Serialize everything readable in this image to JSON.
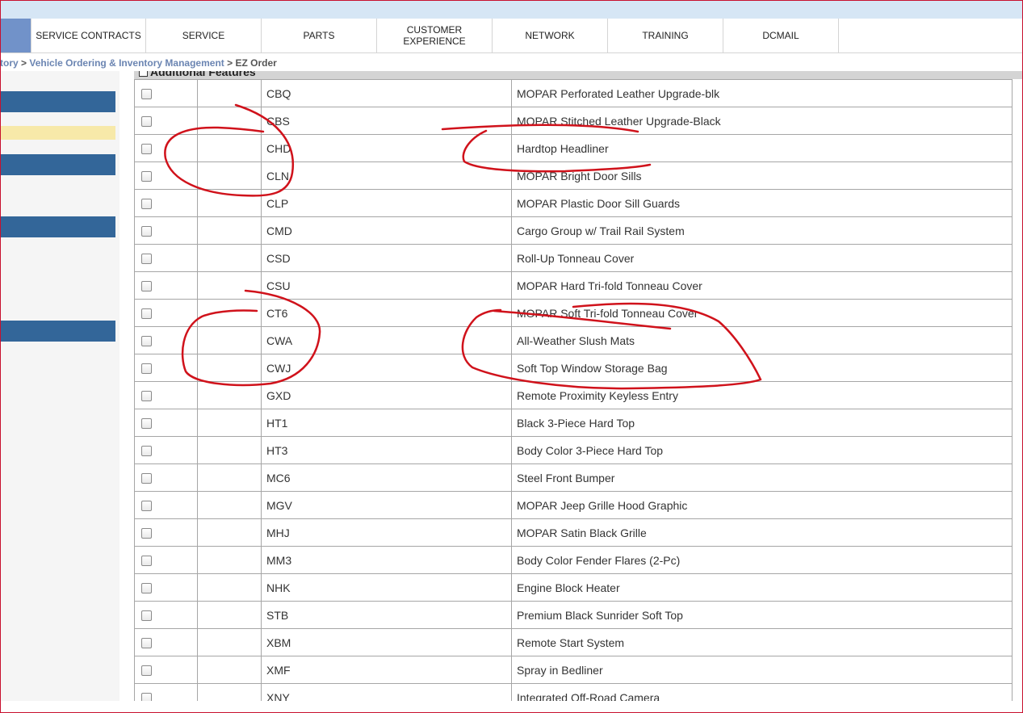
{
  "nav": {
    "tabs": [
      {
        "label": "SERVICE CONTRACTS"
      },
      {
        "label": "SERVICE"
      },
      {
        "label": "PARTS"
      },
      {
        "label": "CUSTOMER EXPERIENCE"
      },
      {
        "label": "NETWORK"
      },
      {
        "label": "TRAINING"
      },
      {
        "label": "DCMAIL"
      }
    ]
  },
  "breadcrumb": {
    "item1": "tory",
    "sep1": ">",
    "item2": "Vehicle Ordering & Inventory Management",
    "sep2": ">",
    "current": "EZ Order"
  },
  "section": {
    "title": "Additional Features"
  },
  "options": [
    {
      "code": "CBQ",
      "description": "MOPAR Perforated Leather Upgrade-blk"
    },
    {
      "code": "CBS",
      "description": "MOPAR Stitched Leather Upgrade-Black"
    },
    {
      "code": "CHD",
      "description": "Hardtop Headliner"
    },
    {
      "code": "CLN",
      "description": "MOPAR Bright Door Sills"
    },
    {
      "code": "CLP",
      "description": "MOPAR Plastic Door Sill Guards"
    },
    {
      "code": "CMD",
      "description": "Cargo Group w/ Trail Rail System"
    },
    {
      "code": "CSD",
      "description": "Roll-Up Tonneau Cover"
    },
    {
      "code": "CSU",
      "description": "MOPAR Hard Tri-fold Tonneau Cover"
    },
    {
      "code": "CT6",
      "description": "MOPAR Soft Tri-fold Tonneau Cover"
    },
    {
      "code": "CWA",
      "description": "All-Weather Slush Mats"
    },
    {
      "code": "CWJ",
      "description": "Soft Top Window Storage Bag"
    },
    {
      "code": "GXD",
      "description": "Remote Proximity Keyless Entry"
    },
    {
      "code": "HT1",
      "description": "Black 3-Piece Hard Top"
    },
    {
      "code": "HT3",
      "description": "Body Color 3-Piece Hard Top"
    },
    {
      "code": "MC6",
      "description": "Steel Front Bumper"
    },
    {
      "code": "MGV",
      "description": "MOPAR Jeep Grille Hood Graphic"
    },
    {
      "code": "MHJ",
      "description": "MOPAR Satin Black Grille"
    },
    {
      "code": "MM3",
      "description": "Body Color Fender Flares (2-Pc)"
    },
    {
      "code": "NHK",
      "description": "Engine Block Heater"
    },
    {
      "code": "STB",
      "description": "Premium Black Sunrider Soft Top"
    },
    {
      "code": "XBM",
      "description": "Remote Start System"
    },
    {
      "code": "XMF",
      "description": "Spray in Bedliner"
    },
    {
      "code": "XNY",
      "description": "Integrated Off-Road Camera"
    }
  ],
  "colors": {
    "nav_home": "#7192c9",
    "sidebar_blue": "#336699",
    "sidebar_yellow": "#f7e9a9",
    "annotation_red": "#d0121b"
  }
}
